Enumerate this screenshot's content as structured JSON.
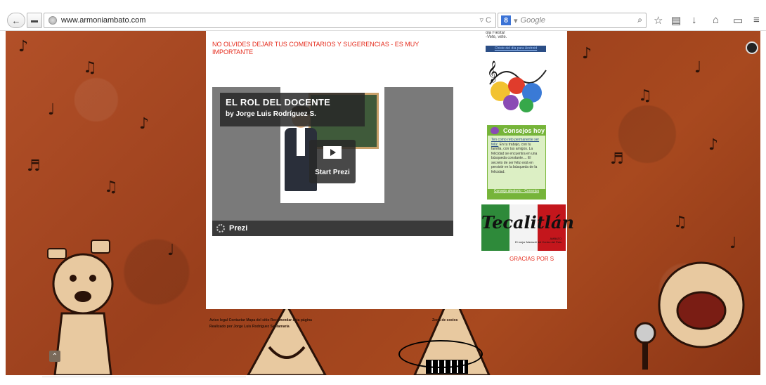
{
  "browser": {
    "url": "www.armoniambato.com",
    "search_engine": "Google"
  },
  "content": {
    "notice": "NO OLVIDES DEJAR TUS COMENTARIOS Y SUGERENCIAS - ES MUY IMPORTANTE",
    "prezi": {
      "title": "EL ROL DEL DOCENTE",
      "author": "by Jorge Luis Rodríguez S.",
      "play_label": "Start Prezi",
      "brand": "Prezi"
    }
  },
  "sidebar": {
    "top_text": "ola Fiesta!",
    "top_text2": "-Vete, vete.",
    "android_link": "Chiste del día para Android",
    "consejos": {
      "title": "Consejos hoy",
      "link_text": "Ten como reto permanente ser feliz.",
      "body": "En tu trabajo, con tu familia, con tus amigos. La felicidad se encuentra en una búsqueda constante.... El secreto de ser feliz está en persistir en la búsqueda de la felicidad.",
      "footer_link": "Consejo aleatorio - Consejos"
    },
    "banner": {
      "title": "Tecalitlán",
      "subtitle": "AMBATO",
      "tagline": "El mejor Mariachi del Centro del País"
    },
    "gracias": "GRACIAS POR S"
  },
  "footer": {
    "col1_line1": "Aviso legal   Contactar   Mapa del sitio   Recomendar esta página",
    "col1_line2": "Realizado por Jorge Luis Rodríguez Santamaría",
    "col2": "Zona de socios"
  },
  "colors": {
    "accent_red": "#e52d1e",
    "consejos_green": "#76b43a",
    "background_brown": "#a8491f"
  }
}
